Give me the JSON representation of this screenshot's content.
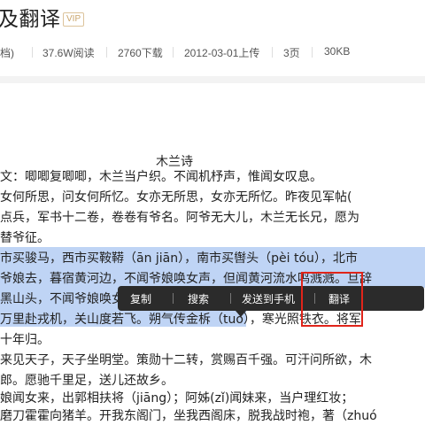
{
  "header": {
    "title": "及翻译",
    "vip_badge": "VIP",
    "meta": {
      "prefix": "档)",
      "reads": "37.6W阅读",
      "downloads": "2760下载",
      "upload_date": "2012-03-01上传",
      "pages": "3页",
      "size": "30KB"
    }
  },
  "document": {
    "poem_title": "木兰诗",
    "lines": [
      "文：唧唧复唧唧，木兰当户织。不闻机杼声，惟闻女叹息。",
      "女何所思，问女何所忆。女亦无所思，女亦无所忆。昨夜见军帖(",
      "点兵，军书十二卷，卷卷有爷名。阿爷无大儿，木兰无长兄，愿为",
      "替爷征。",
      "市买骏马，西市买鞍鞯（ān jiān），南市买辔头（pèi tóu），北市",
      "爷娘去，暮宿黄河边，不闻爷娘唤女声，但闻黄河流水鸣溅溅。旦辞",
      "黑山头，不闻爷娘唤女声，但闻燕山胡骑鸣啾啾。",
      "万里赴戎机，关山度若飞。朔气传金柝（tuò），寒光照铁衣。将军",
      "十年归。",
      "来见天子，天子坐明堂。策勋十二转，赏赐百千强。可汗问所欲，木",
      "郎。愿驰千里足，送儿还故乡。",
      "娘闻女来，出郭相扶将（jiāng）；阿姊(zǐ)闻妹来，当户理红妆；",
      "磨刀霍霍向猪羊。开我东阁门，坐我西阁床，脱我战时袍，著（zhuó"
    ]
  },
  "context_menu": {
    "items": [
      "复制",
      "搜索",
      "发送到手机",
      "翻译"
    ],
    "highlighted": "翻译"
  },
  "colors": {
    "selection": "#bfd4f5",
    "toolbar": "#2b2b2b",
    "highlight_box": "#e0241a",
    "vip": "#c9a46a"
  }
}
